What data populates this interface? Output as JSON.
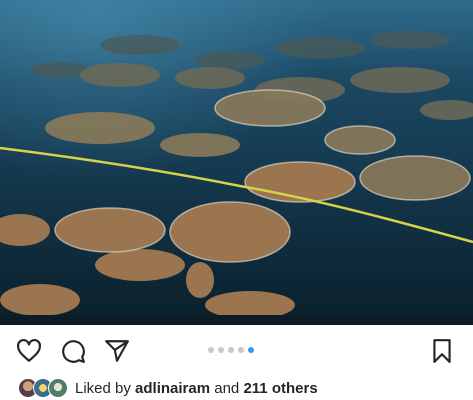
{
  "post": {
    "photo_icon": "underwater-coral-reef-photo",
    "carousel": {
      "total": 5,
      "active_index": 4,
      "active_color": "#3897f0",
      "inactive_color": "#c8c8c8"
    },
    "actions": {
      "like_icon": "heart-icon",
      "comment_icon": "comment-icon",
      "share_icon": "send-icon",
      "save_icon": "bookmark-icon"
    },
    "likes": {
      "prefix": "Liked by ",
      "user": "adlinairam",
      "middle": " and ",
      "others": "211 others"
    }
  }
}
